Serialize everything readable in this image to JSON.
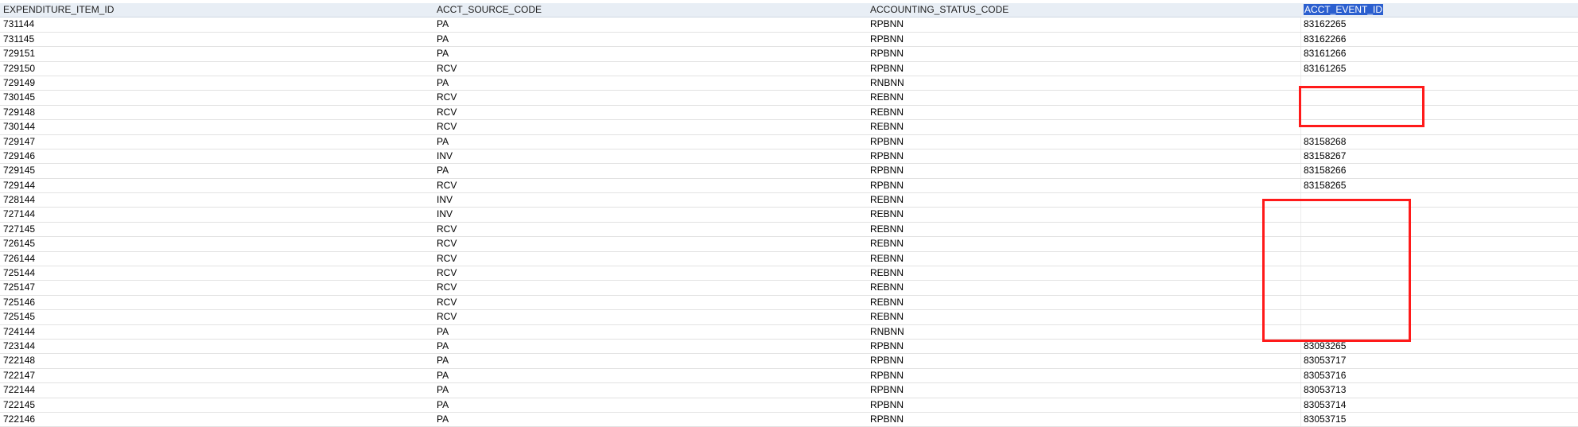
{
  "columns": [
    "EXPENDITURE_ITEM_ID",
    "ACCT_SOURCE_CODE",
    "ACCOUNTING_STATUS_CODE",
    "ACCT_EVENT_ID"
  ],
  "rows": [
    [
      "731144",
      "PA",
      "RPBNN",
      "83162265"
    ],
    [
      "731145",
      "PA",
      "RPBNN",
      "83162266"
    ],
    [
      "729151",
      "PA",
      "RPBNN",
      "83161266"
    ],
    [
      "729150",
      "RCV",
      "RPBNN",
      "83161265"
    ],
    [
      "729149",
      "PA",
      "RNBNN",
      ""
    ],
    [
      "730145",
      "RCV",
      "REBNN",
      ""
    ],
    [
      "729148",
      "RCV",
      "REBNN",
      ""
    ],
    [
      "730144",
      "RCV",
      "REBNN",
      ""
    ],
    [
      "729147",
      "PA",
      "RPBNN",
      "83158268"
    ],
    [
      "729146",
      "INV",
      "RPBNN",
      "83158267"
    ],
    [
      "729145",
      "PA",
      "RPBNN",
      "83158266"
    ],
    [
      "729144",
      "RCV",
      "RPBNN",
      "83158265"
    ],
    [
      "728144",
      "INV",
      "REBNN",
      ""
    ],
    [
      "727144",
      "INV",
      "REBNN",
      ""
    ],
    [
      "727145",
      "RCV",
      "REBNN",
      ""
    ],
    [
      "726145",
      "RCV",
      "REBNN",
      ""
    ],
    [
      "726144",
      "RCV",
      "REBNN",
      ""
    ],
    [
      "725144",
      "RCV",
      "REBNN",
      ""
    ],
    [
      "725147",
      "RCV",
      "REBNN",
      ""
    ],
    [
      "725146",
      "RCV",
      "REBNN",
      ""
    ],
    [
      "725145",
      "RCV",
      "REBNN",
      ""
    ],
    [
      "724144",
      "PA",
      "RNBNN",
      ""
    ],
    [
      "723144",
      "PA",
      "RPBNN",
      "83093265"
    ],
    [
      "722148",
      "PA",
      "RPBNN",
      "83053717"
    ],
    [
      "722147",
      "PA",
      "RPBNN",
      "83053716"
    ],
    [
      "722144",
      "PA",
      "RPBNN",
      "83053713"
    ],
    [
      "722145",
      "PA",
      "RPBNN",
      "83053714"
    ],
    [
      "722146",
      "PA",
      "RPBNN",
      "83053715"
    ]
  ],
  "selected_column": "ACCT_EVENT_ID",
  "colors": {
    "header_bg": "#e8eef5",
    "selection": "#2b5fcf",
    "highlight": "#ff1a1a",
    "grid_line": "#e2e2e2"
  }
}
